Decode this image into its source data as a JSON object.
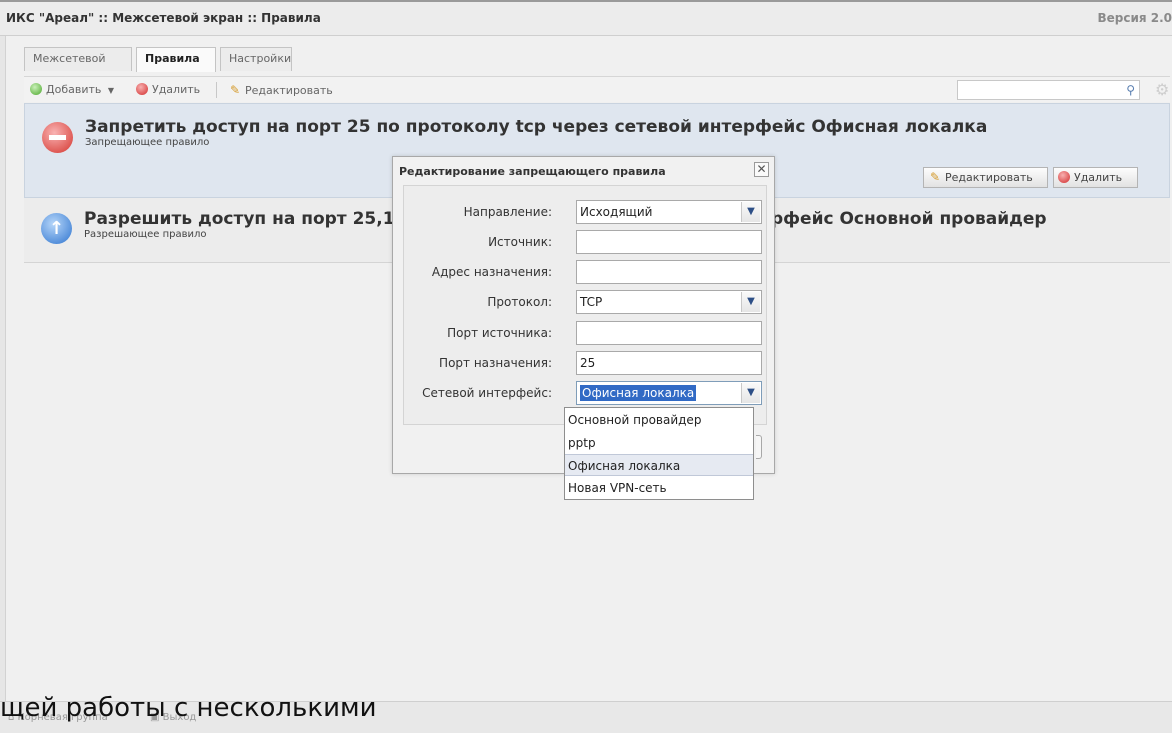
{
  "app": {
    "title": "ИКС \"Ареал\" :: Межсетевой экран :: Правила",
    "version": "Версия 2.0"
  },
  "tabs": [
    {
      "label": "Межсетевой экран",
      "active": false
    },
    {
      "label": "Правила",
      "active": true
    },
    {
      "label": "Настройки",
      "active": false
    }
  ],
  "toolbar": {
    "add_label": "Добавить",
    "delete_label": "Удалить",
    "edit_label": "Редактировать",
    "search_value": ""
  },
  "rules": [
    {
      "title": "Запретить доступ на порт 25 по протоколу tcp через сетевой интерфейс Офисная локалка",
      "subtitle": "Запрещающее правило",
      "edit_label": "Редактировать",
      "delete_label": "Удалить"
    },
    {
      "title_left": "Разрешить доступ на порт 25,110,",
      "title_right": "рфейс Основной провайдер",
      "subtitle": "Разрешающее правило"
    }
  ],
  "dialog": {
    "title": "Редактирование запрещающего правила",
    "close_symbol": "✕",
    "fields": {
      "direction": {
        "label": "Направление:",
        "value": "Исходящий"
      },
      "source": {
        "label": "Источник:",
        "value": ""
      },
      "destination": {
        "label": "Адрес назначения:",
        "value": ""
      },
      "protocol": {
        "label": "Протокол:",
        "value": "TCP"
      },
      "source_port": {
        "label": "Порт источника:",
        "value": ""
      },
      "dest_port": {
        "label": "Порт назначения:",
        "value": "25"
      },
      "interface": {
        "label": "Сетевой интерфейс:",
        "value": "Офисная локалка"
      }
    }
  },
  "dropdown": {
    "options": [
      "Основной провайдер",
      "pptp",
      "Офисная локалка",
      "Новая VPN-сеть"
    ],
    "highlighted_index": 2
  },
  "statusbar": {
    "group_label": "Корневая группа",
    "exit_label": "Выход"
  },
  "overlay_text": "щей работы с несколькими",
  "icons": {
    "add": "plus-circle-icon",
    "delete": "minus-circle-icon",
    "edit": "pencil-icon",
    "search": "magnifier-icon",
    "settings": "gear-icon"
  },
  "colors": {
    "rule_selected_bg": "#dfe6ef",
    "deny_red": "#d4352e",
    "allow_blue": "#2e74cf",
    "selection_blue": "#316ac5"
  }
}
